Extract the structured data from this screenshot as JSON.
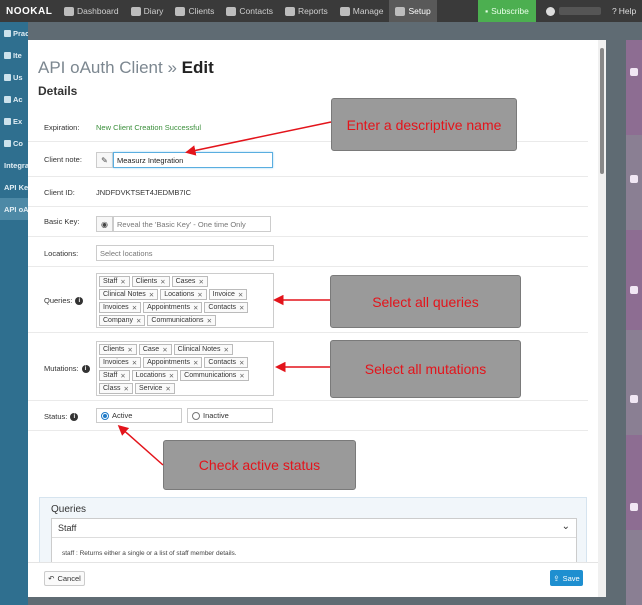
{
  "navbar": {
    "brand": "NOOKAL",
    "items": [
      {
        "label": "Dashboard",
        "icon": "home-icon"
      },
      {
        "label": "Diary",
        "icon": "calendar-icon"
      },
      {
        "label": "Clients",
        "icon": "users-icon"
      },
      {
        "label": "Contacts",
        "icon": "card-icon"
      },
      {
        "label": "Reports",
        "icon": "chart-icon"
      },
      {
        "label": "Manage",
        "icon": "wrench-icon"
      },
      {
        "label": "Setup",
        "icon": "gear-icon",
        "active": true
      }
    ],
    "subscribe": "Subscribe",
    "help": "Help"
  },
  "sidebar": {
    "items": [
      "Practice",
      "Ite",
      "Us",
      "Ac",
      "Ex",
      "Co",
      "Integra",
      "API Ke",
      "API oA"
    ]
  },
  "modal": {
    "title_prefix": "API oAuth Client »",
    "title_action": "Edit",
    "subtitle": "Details",
    "fields": {
      "expiration_label": "Expiration:",
      "expiration_value": "New Client Creation Successful",
      "client_note_label": "Client note:",
      "client_note_value": "Measurz Integration",
      "client_id_label": "Client ID:",
      "client_id_value": "JNDFDVKTSET4JEDMB7IC",
      "basic_key_label": "Basic Key:",
      "basic_key_placeholder": "Reveal the 'Basic Key' - One time Only",
      "locations_label": "Locations:",
      "locations_placeholder": "Select locations",
      "queries_label": "Queries:",
      "mutations_label": "Mutations:",
      "status_label": "Status:",
      "status_active": "Active",
      "status_inactive": "Inactive",
      "status_selected": "Active"
    },
    "queries": [
      "Staff",
      "Clients",
      "Cases",
      "Clinical Notes",
      "Locations",
      "Invoice",
      "Invoices",
      "Appointments",
      "Contacts",
      "Company",
      "Communications"
    ],
    "mutations": [
      "Clients",
      "Case",
      "Clinical Notes",
      "Invoices",
      "Appointments",
      "Contacts",
      "Staff",
      "Locations",
      "Communications",
      "Class",
      "Service"
    ],
    "queries_panel": {
      "title": "Queries",
      "accordion_title": "Staff",
      "accordion_body": "staff : Returns either a single or a list of staff member details."
    },
    "footer": {
      "cancel": "Cancel",
      "save": "Save"
    }
  },
  "callouts": {
    "name": "Enter a descriptive name",
    "queries": "Select all queries",
    "mutations": "Select all mutations",
    "status": "Check active status"
  },
  "colors": {
    "navbar": "#3a3a3a",
    "sidebar": "#2f6f8f",
    "subscribe": "#4caf50",
    "primary": "#1e8fd0",
    "success_text": "#3b8f3b",
    "callout_bg": "#9a9a9a",
    "callout_text": "#e3141b"
  }
}
